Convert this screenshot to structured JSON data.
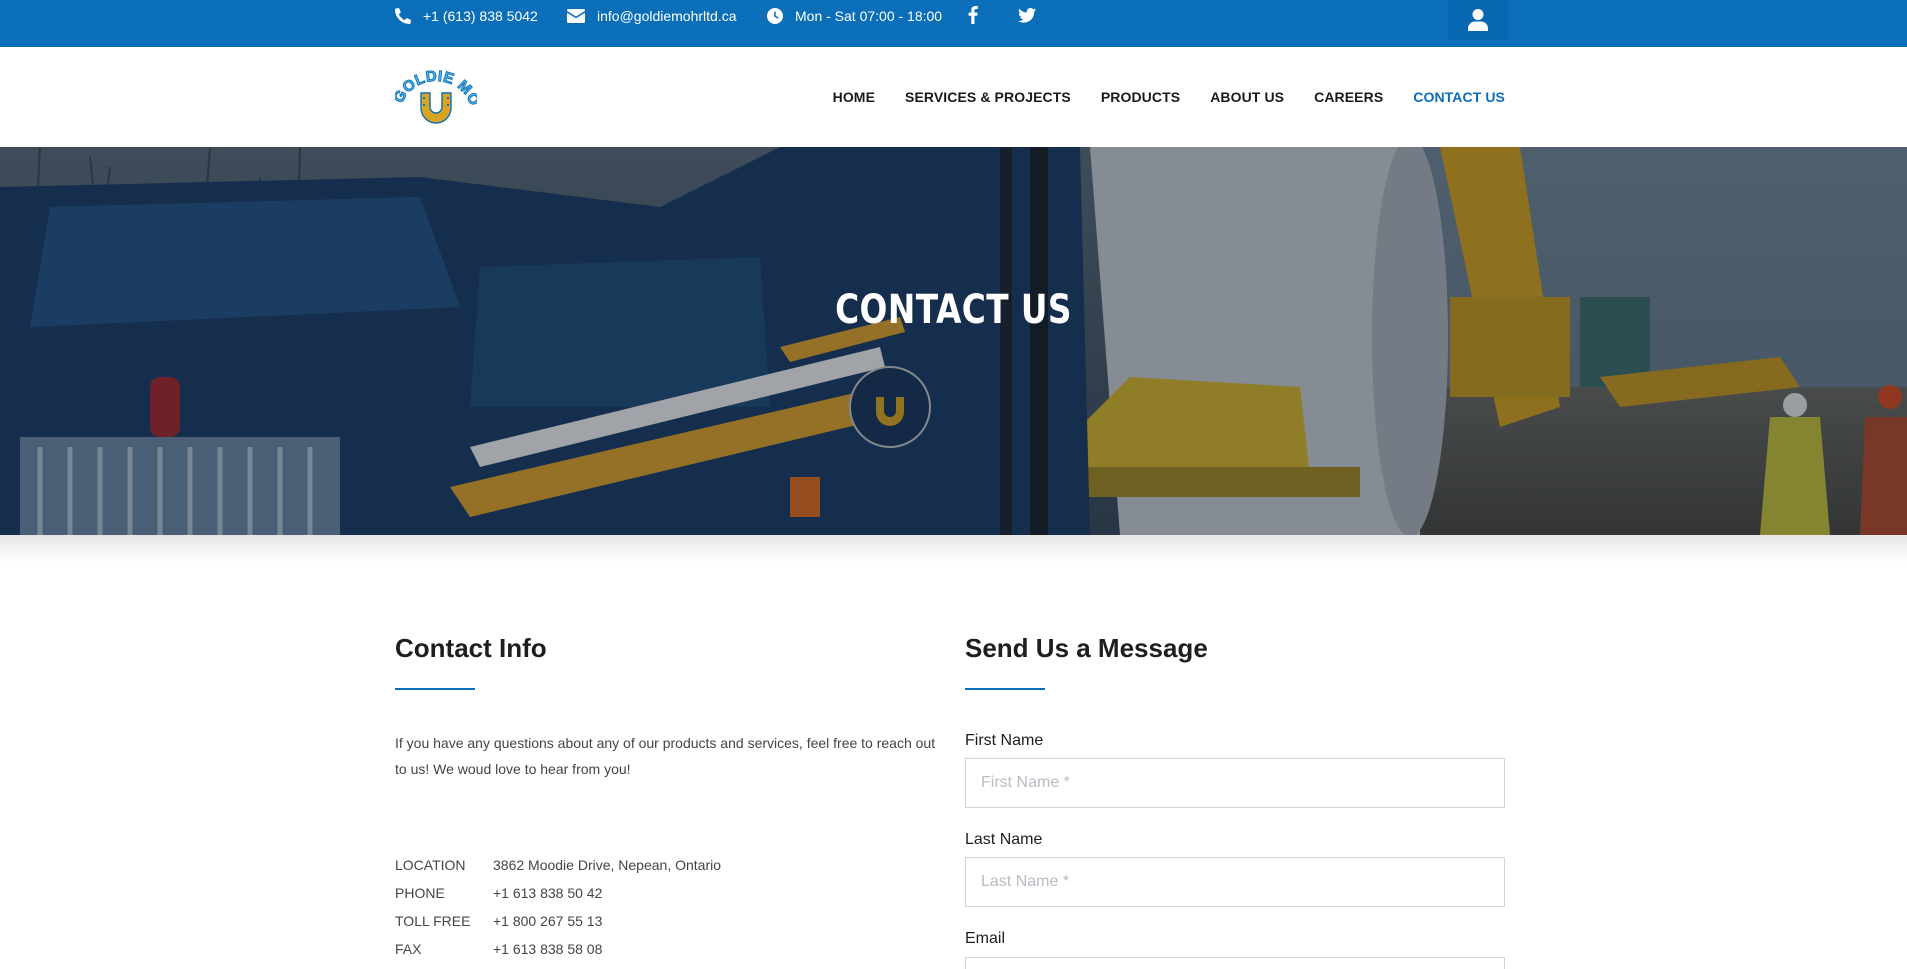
{
  "topbar": {
    "phone": "+1 (613) 838 5042",
    "email": "info@goldiemohrltd.ca",
    "hours": "Mon - Sat 07:00 - 18:00",
    "icons": [
      "phone-icon",
      "envelope-icon",
      "clock-icon",
      "facebook-icon",
      "twitter-icon",
      "user-icon"
    ],
    "background": "#0a6eb9"
  },
  "nav": {
    "logo_text": "GOLDIE MOHR LTD",
    "logo_letter": "U",
    "items": [
      {
        "label": "HOME"
      },
      {
        "label": "SERVICES & PROJECTS"
      },
      {
        "label": "PRODUCTS"
      },
      {
        "label": "ABOUT US"
      },
      {
        "label": "CAREERS"
      },
      {
        "label": "CONTACT US",
        "active": true
      }
    ],
    "accent": "#0a6eb9"
  },
  "hero": {
    "title": "CONTACT US"
  },
  "contact_info": {
    "title": "Contact Info",
    "intro": "If you have any questions about any of our products and services, feel free to reach out to us! We woud love to hear from you!",
    "rows": [
      {
        "label": "LOCATION",
        "value": "3862 Moodie Drive, Nepean, Ontario"
      },
      {
        "label": "PHONE",
        "value": "+1 613 838 50 42"
      },
      {
        "label": "TOLL FREE",
        "value": "+1 800 267 55 13"
      },
      {
        "label": "FAX",
        "value": "+1 613 838 58 08"
      }
    ]
  },
  "form": {
    "title": "Send Us a Message",
    "first_name": {
      "label": "First Name",
      "placeholder": "First Name *",
      "value": ""
    },
    "last_name": {
      "label": "Last Name",
      "placeholder": "Last Name *",
      "value": ""
    },
    "email": {
      "label": "Email"
    }
  }
}
